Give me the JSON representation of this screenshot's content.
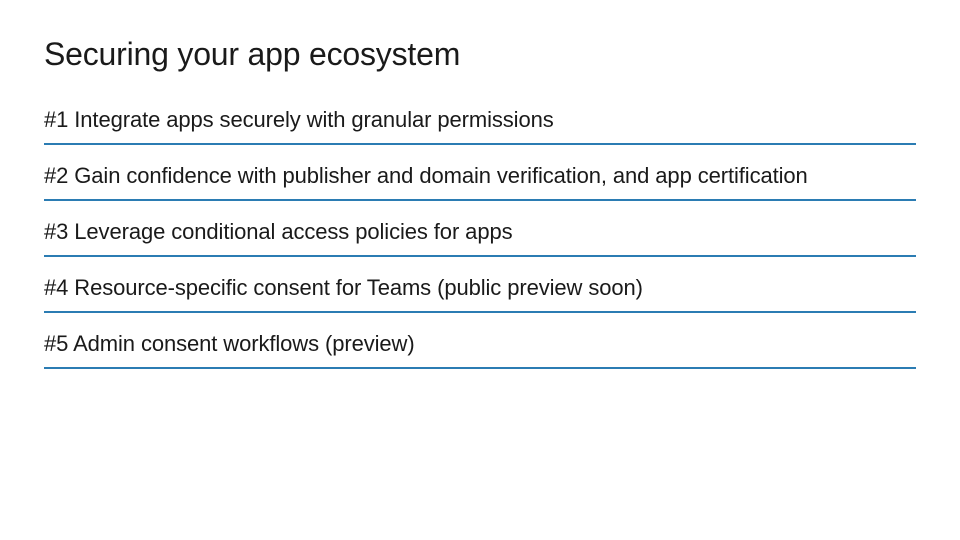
{
  "title": "Securing your app ecosystem",
  "items": [
    "#1 Integrate apps securely with granular permissions",
    "#2 Gain confidence with publisher and domain verification, and app certification",
    "#3 Leverage conditional access policies for apps",
    "#4 Resource-specific consent for Teams (public preview soon)",
    "#5 Admin consent workflows (preview)"
  ]
}
